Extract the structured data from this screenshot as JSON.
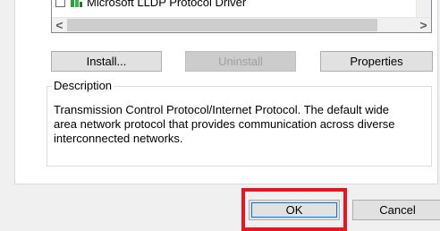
{
  "component_list": {
    "partial_item_label": "Microsoft LLDP Protocol Driver",
    "checked": false
  },
  "scrollbar": {
    "left_arrow": "<",
    "right_arrow": ">"
  },
  "buttons": {
    "install": "Install...",
    "uninstall": "Uninstall",
    "properties": "Properties",
    "ok": "OK",
    "cancel": "Cancel"
  },
  "description": {
    "legend": "Description",
    "text": "Transmission Control Protocol/Internet Protocol. The default wide area network protocol that provides communication across diverse interconnected networks."
  },
  "colors": {
    "highlight": "#e8141e",
    "dialog_background": "#f0f0f0",
    "panel_background": "#ffffff"
  },
  "icons": [
    "network-protocol-icon",
    "scroll-left-icon",
    "scroll-right-icon"
  ]
}
